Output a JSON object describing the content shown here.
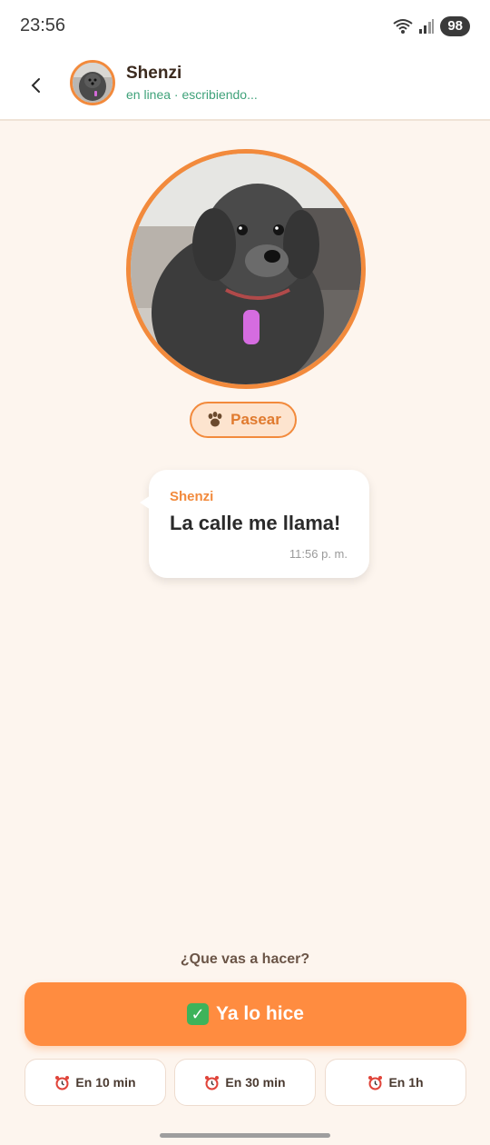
{
  "status_bar": {
    "time": "23:56",
    "battery": "98"
  },
  "header": {
    "name": "Shenzi",
    "status": "en linea · escribiendo..."
  },
  "activity_chip": {
    "label": "Pasear",
    "icon": "paw-icon"
  },
  "message": {
    "sender": "Shenzi",
    "text": "La calle me llama!",
    "time": "11:56 p. m."
  },
  "actions": {
    "question": "¿Que vas a hacer?",
    "done_label": "Ya lo hice",
    "snooze": [
      {
        "label": "En 10 min"
      },
      {
        "label": "En 30 min"
      },
      {
        "label": "En 1h"
      }
    ]
  },
  "colors": {
    "accent": "#ff8c40",
    "online": "#3fa27a",
    "background": "#fdf5ee"
  }
}
